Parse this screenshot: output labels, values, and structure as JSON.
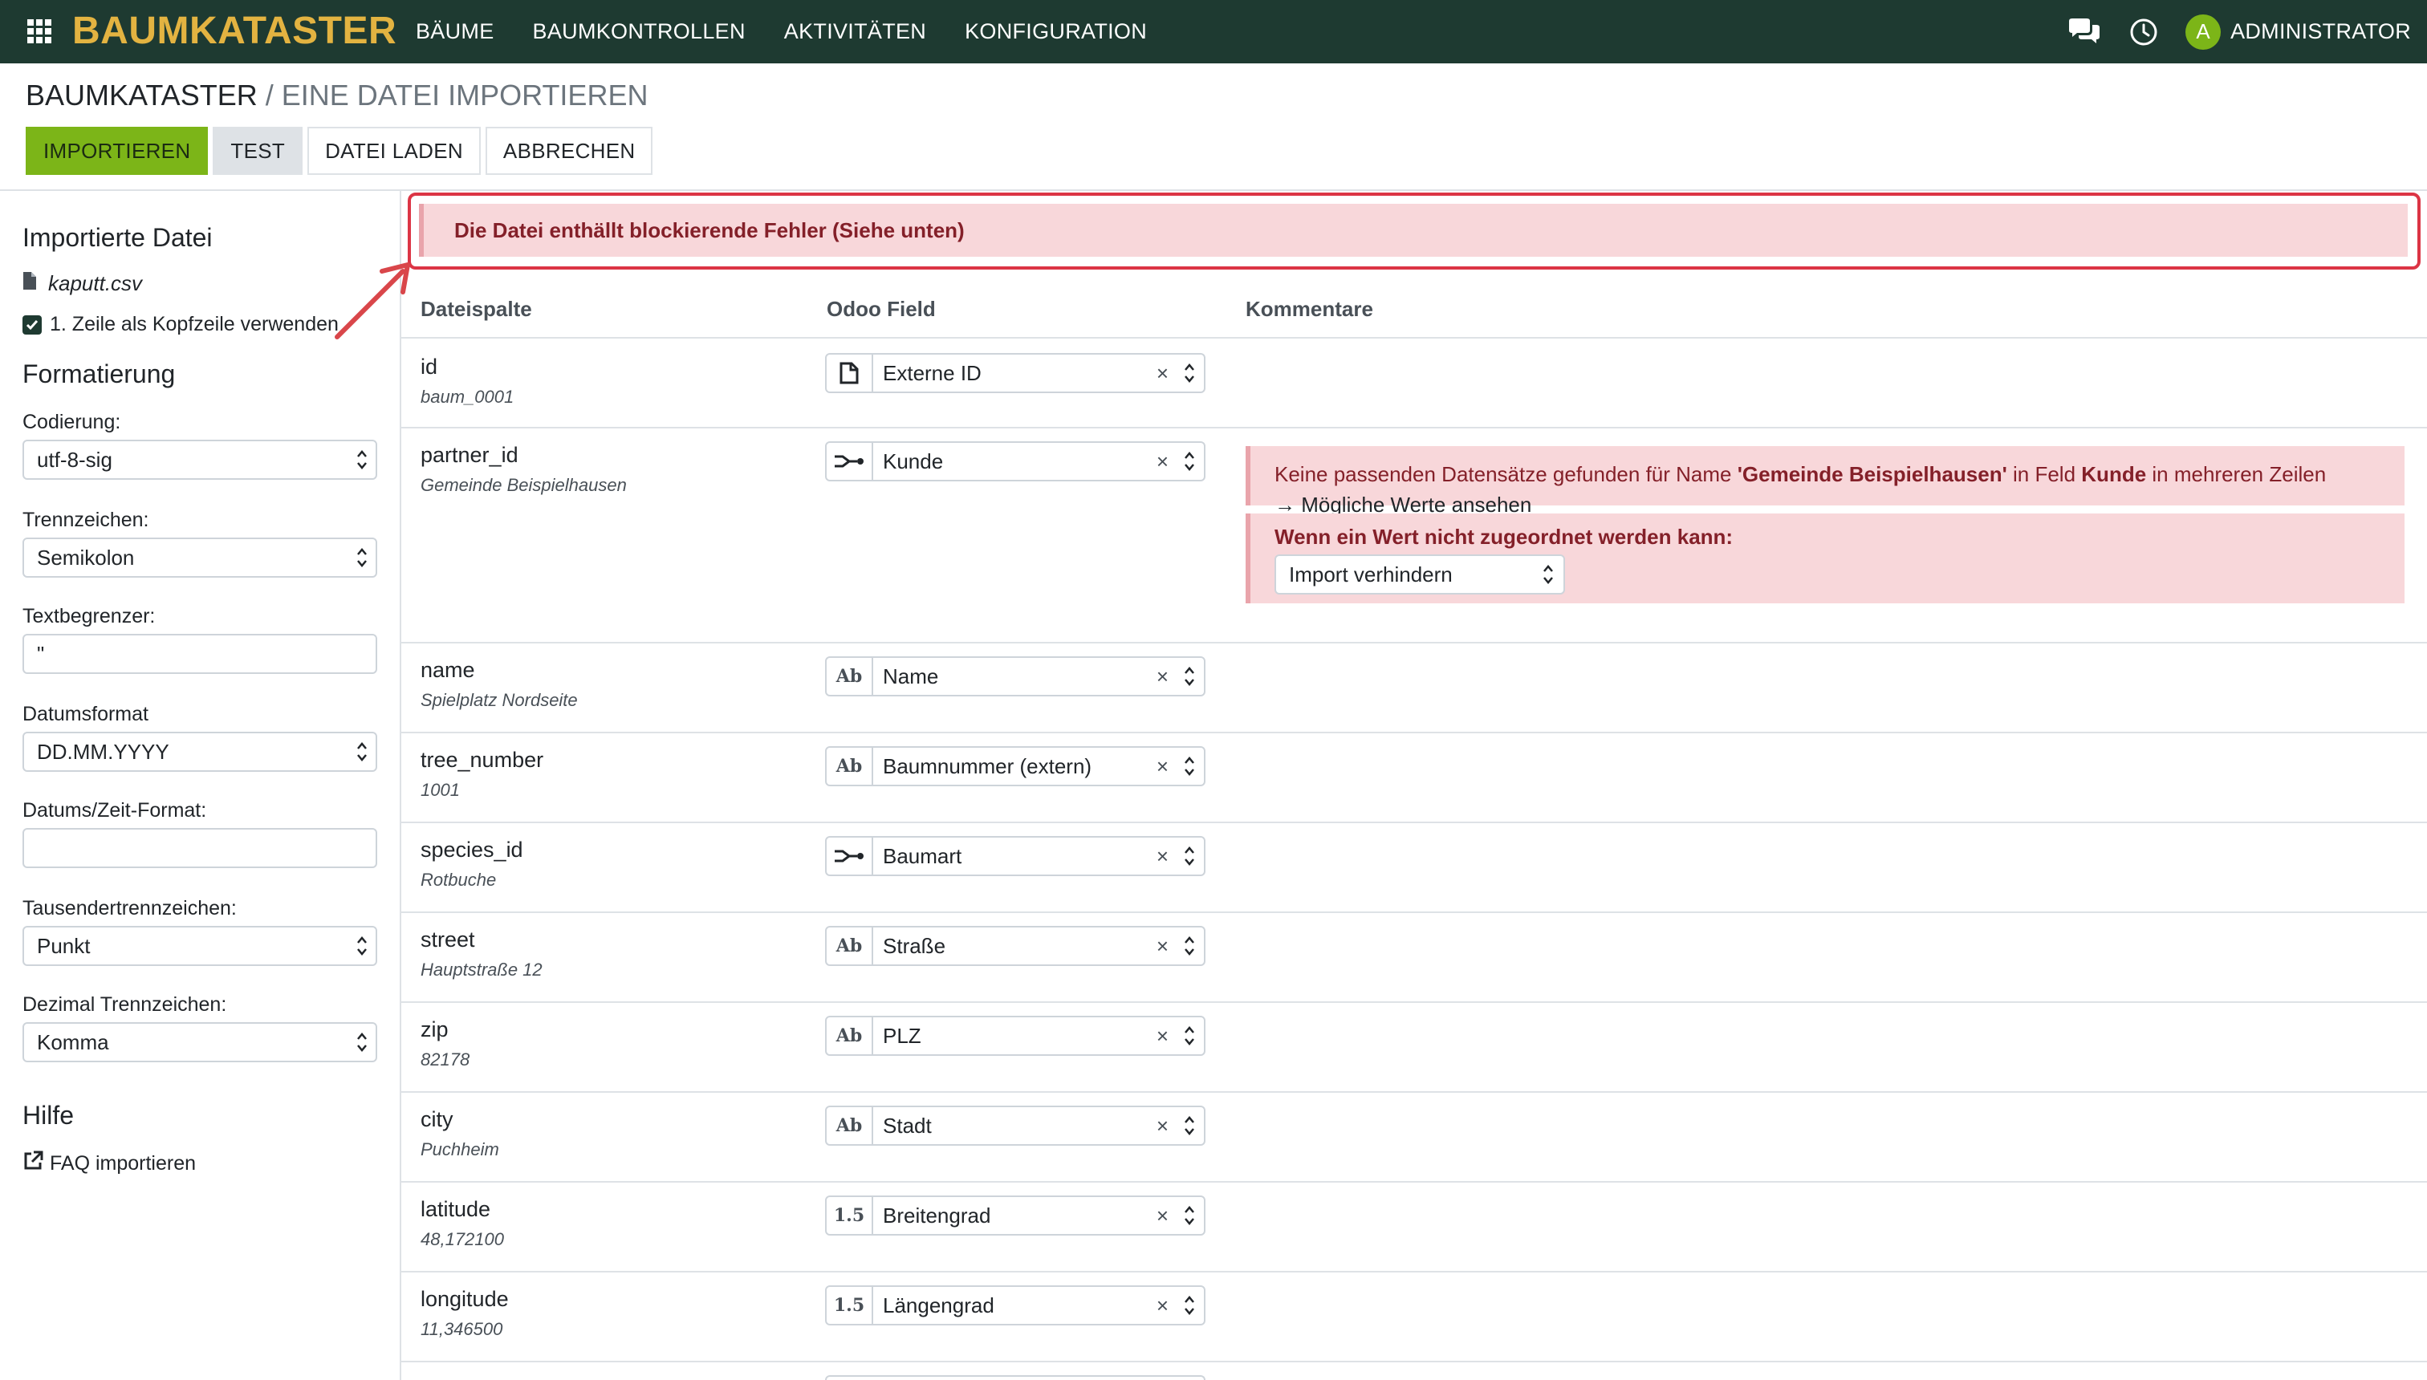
{
  "nav": {
    "brand": "BAUMKATASTER",
    "menu": [
      "BÄUME",
      "BAUMKONTROLLEN",
      "AKTIVITÄTEN",
      "KONFIGURATION"
    ],
    "user_initial": "A",
    "user_name": "ADMINISTRATOR",
    "avatar_color": "#7cb518"
  },
  "breadcrumb": {
    "root": "BAUMKATASTER",
    "separator": "/",
    "current": "EINE DATEI IMPORTIEREN"
  },
  "toolbar": {
    "import_label": "IMPORTIEREN",
    "test_label": "TEST",
    "load_label": "DATEI LADEN",
    "cancel_label": "ABBRECHEN"
  },
  "sidebar": {
    "imported_title": "Importierte Datei",
    "file_name": "kaputt.csv",
    "header_checkbox_label": "1. Zeile als Kopfzeile verwenden",
    "header_checkbox_checked": true,
    "formatting_title": "Formatierung",
    "encoding_label": "Codierung:",
    "encoding_value": "utf-8-sig",
    "separator_label": "Trennzeichen:",
    "separator_value": "Semikolon",
    "quote_label": "Textbegrenzer:",
    "quote_value": "\"",
    "date_label": "Datumsformat",
    "date_value": "DD.MM.YYYY",
    "datetime_label": "Datums/Zeit-Format:",
    "datetime_value": "",
    "thousands_label": "Tausendertrennzeichen:",
    "thousands_value": "Punkt",
    "decimal_label": "Dezimal Trennzeichen:",
    "decimal_value": "Komma",
    "help_title": "Hilfe",
    "faq_label": "FAQ importieren"
  },
  "alert": {
    "text": "Die Datei enthällt blockierende Fehler (Siehe unten)",
    "color": "#842029"
  },
  "table": {
    "headers": {
      "column": "Dateispalte",
      "field": "Odoo Field",
      "comments": "Kommentare"
    },
    "rows": [
      {
        "name": "id",
        "sample": "baum_0001",
        "field_type": "file",
        "field": "Externe ID"
      },
      {
        "name": "partner_id",
        "sample": "Gemeinde Beispielhausen",
        "field_type": "relation",
        "field": "Kunde"
      },
      {
        "name": "name",
        "sample": "Spielplatz Nordseite",
        "field_type": "Ab",
        "field": "Name"
      },
      {
        "name": "tree_number",
        "sample": "1001",
        "field_type": "Ab",
        "field": "Baumnummer (extern)"
      },
      {
        "name": "species_id",
        "sample": "Rotbuche",
        "field_type": "relation",
        "field": "Baumart"
      },
      {
        "name": "street",
        "sample": "Hauptstraße 12",
        "field_type": "Ab",
        "field": "Straße"
      },
      {
        "name": "zip",
        "sample": "82178",
        "field_type": "Ab",
        "field": "PLZ"
      },
      {
        "name": "city",
        "sample": "Puchheim",
        "field_type": "Ab",
        "field": "Stadt"
      },
      {
        "name": "latitude",
        "sample": "48,172100",
        "field_type": "1.5",
        "field": "Breitengrad"
      },
      {
        "name": "longitude",
        "sample": "11,346500",
        "field_type": "1.5",
        "field": "Längengrad"
      }
    ]
  },
  "comment": {
    "msg_prefix": "Keine passenden Datensätze gefunden für Name ",
    "msg_value": "'Gemeinde Beispielhausen'",
    "msg_mid": " in Feld ",
    "msg_field": "Kunde",
    "msg_suffix": " in mehreren Zeilen",
    "link": "→ Mögliche Werte ansehen",
    "policy_title": "Wenn ein Wert nicht zugeordnet werden kann:",
    "policy_value": "Import verhindern"
  }
}
